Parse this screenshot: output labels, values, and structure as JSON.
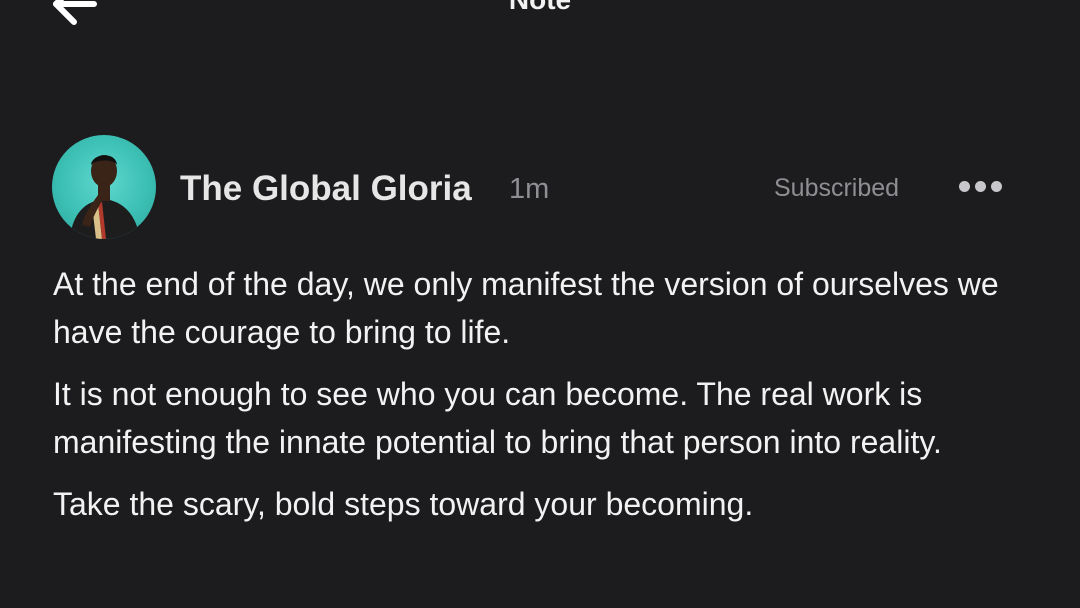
{
  "header": {
    "title": "Note",
    "back_icon": "arrow-left-icon"
  },
  "note": {
    "author": "The Global Gloria",
    "time": "1m",
    "subscription_status": "Subscribed",
    "more_icon": "more-horizontal-icon",
    "paragraphs": [
      "At the end of the day, we only manifest the version of ourselves we have the courage to bring to life.",
      "It is not enough to see who you can become. The real work is manifesting the innate potential to bring that person into reality.",
      "Take the scary, bold steps toward your becoming."
    ]
  },
  "colors": {
    "background": "#1c1c1e",
    "text": "#f2f2f2",
    "muted": "#8e8e93",
    "avatar_bg": "#3cbfb4"
  }
}
